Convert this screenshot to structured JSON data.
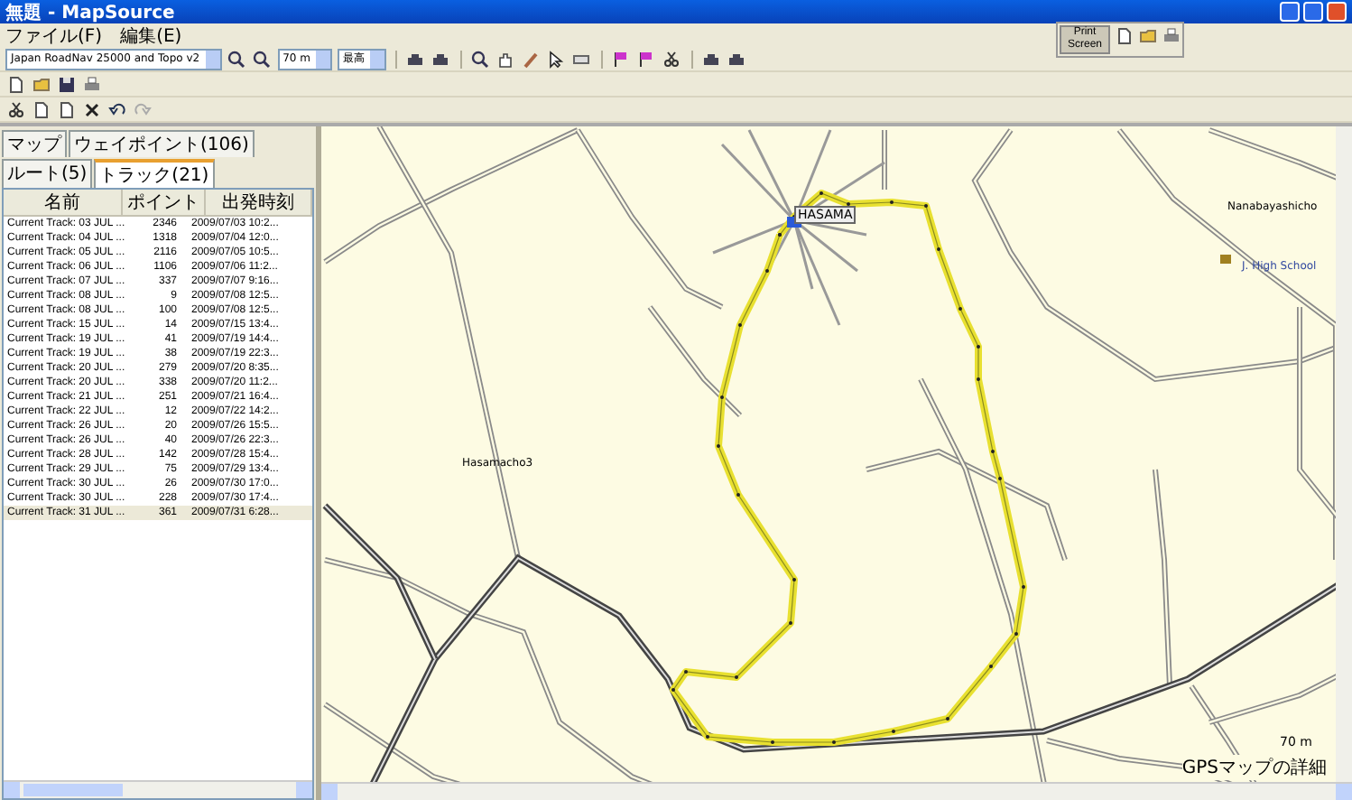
{
  "window": {
    "title": "無題 - MapSource"
  },
  "menu": [
    "ファイル(F)",
    "編集(E)"
  ],
  "toolbar": {
    "map_product": "Japan RoadNav 25000 and Topo v2",
    "zoom": "70 m",
    "detail": "最高"
  },
  "floating_toolbar": {
    "button": "Print Screen"
  },
  "tabs": [
    {
      "label": "マップ",
      "selected": false
    },
    {
      "label": "ウェイポイント(106)",
      "selected": false
    },
    {
      "label": "ルート(5)",
      "selected": false
    },
    {
      "label": "トラック(21)",
      "selected": true
    }
  ],
  "table": {
    "columns": [
      "名前",
      "ポイント",
      "出発時刻"
    ],
    "rows": [
      {
        "name": "Current Track: 03 JUL ...",
        "points": "2346",
        "start": "2009/07/03 10:2...",
        "selected": false
      },
      {
        "name": "Current Track: 04 JUL ...",
        "points": "1318",
        "start": "2009/07/04 12:0...",
        "selected": false
      },
      {
        "name": "Current Track: 05 JUL ...",
        "points": "2116",
        "start": "2009/07/05 10:5...",
        "selected": false
      },
      {
        "name": "Current Track: 06 JUL ...",
        "points": "1106",
        "start": "2009/07/06 11:2...",
        "selected": false
      },
      {
        "name": "Current Track: 07 JUL ...",
        "points": "337",
        "start": "2009/07/07 9:16...",
        "selected": false
      },
      {
        "name": "Current Track: 08 JUL ...",
        "points": "9",
        "start": "2009/07/08 12:5...",
        "selected": false
      },
      {
        "name": "Current Track: 08 JUL ...",
        "points": "100",
        "start": "2009/07/08 12:5...",
        "selected": false
      },
      {
        "name": "Current Track: 15 JUL ...",
        "points": "14",
        "start": "2009/07/15 13:4...",
        "selected": false
      },
      {
        "name": "Current Track: 19 JUL ...",
        "points": "41",
        "start": "2009/07/19 14:4...",
        "selected": false
      },
      {
        "name": "Current Track: 19 JUL ...",
        "points": "38",
        "start": "2009/07/19 22:3...",
        "selected": false
      },
      {
        "name": "Current Track: 20 JUL ...",
        "points": "279",
        "start": "2009/07/20 8:35...",
        "selected": false
      },
      {
        "name": "Current Track: 20 JUL ...",
        "points": "338",
        "start": "2009/07/20 11:2...",
        "selected": false
      },
      {
        "name": "Current Track: 21 JUL ...",
        "points": "251",
        "start": "2009/07/21 16:4...",
        "selected": false
      },
      {
        "name": "Current Track: 22 JUL ...",
        "points": "12",
        "start": "2009/07/22 14:2...",
        "selected": false
      },
      {
        "name": "Current Track: 26 JUL ...",
        "points": "20",
        "start": "2009/07/26 15:5...",
        "selected": false
      },
      {
        "name": "Current Track: 26 JUL ...",
        "points": "40",
        "start": "2009/07/26 22:3...",
        "selected": false
      },
      {
        "name": "Current Track: 28 JUL ...",
        "points": "142",
        "start": "2009/07/28 15:4...",
        "selected": false
      },
      {
        "name": "Current Track: 29 JUL ...",
        "points": "75",
        "start": "2009/07/29 13:4...",
        "selected": false
      },
      {
        "name": "Current Track: 30 JUL ...",
        "points": "26",
        "start": "2009/07/30 17:0...",
        "selected": false
      },
      {
        "name": "Current Track: 30 JUL ...",
        "points": "228",
        "start": "2009/07/30 17:4...",
        "selected": false
      },
      {
        "name": "Current Track: 31 JUL ...",
        "points": "361",
        "start": "2009/07/31 6:28...",
        "selected": true
      }
    ]
  },
  "map": {
    "labels": [
      {
        "text": "HASAMA",
        "kind": "town"
      },
      {
        "text": "Nanabayashicho",
        "kind": "place"
      },
      {
        "text": "J. High School",
        "kind": "school"
      },
      {
        "text": "Hasamacho3",
        "kind": "place"
      }
    ],
    "scale": "70 m",
    "footer": "GPSマップの詳細"
  }
}
